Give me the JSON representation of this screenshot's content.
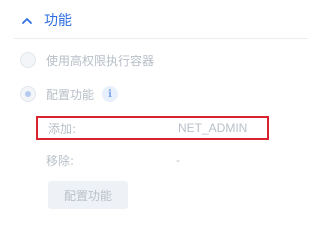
{
  "section": {
    "title": "功能",
    "chevron_icon": "chevron-up-icon",
    "accent_color": "#2f6fe0"
  },
  "options": {
    "privileged": {
      "label": "使用高权限执行容器",
      "checked": false
    },
    "configure": {
      "label": "配置功能",
      "checked": true,
      "info_icon": "info-icon",
      "info_glyph": "i"
    }
  },
  "capabilities": {
    "add": {
      "label": "添加:",
      "value": "NET_ADMIN"
    },
    "remove": {
      "label": "移除:",
      "value": "-"
    }
  },
  "configure_button": {
    "label": "配置功能"
  },
  "highlight_color": "#d9242f"
}
